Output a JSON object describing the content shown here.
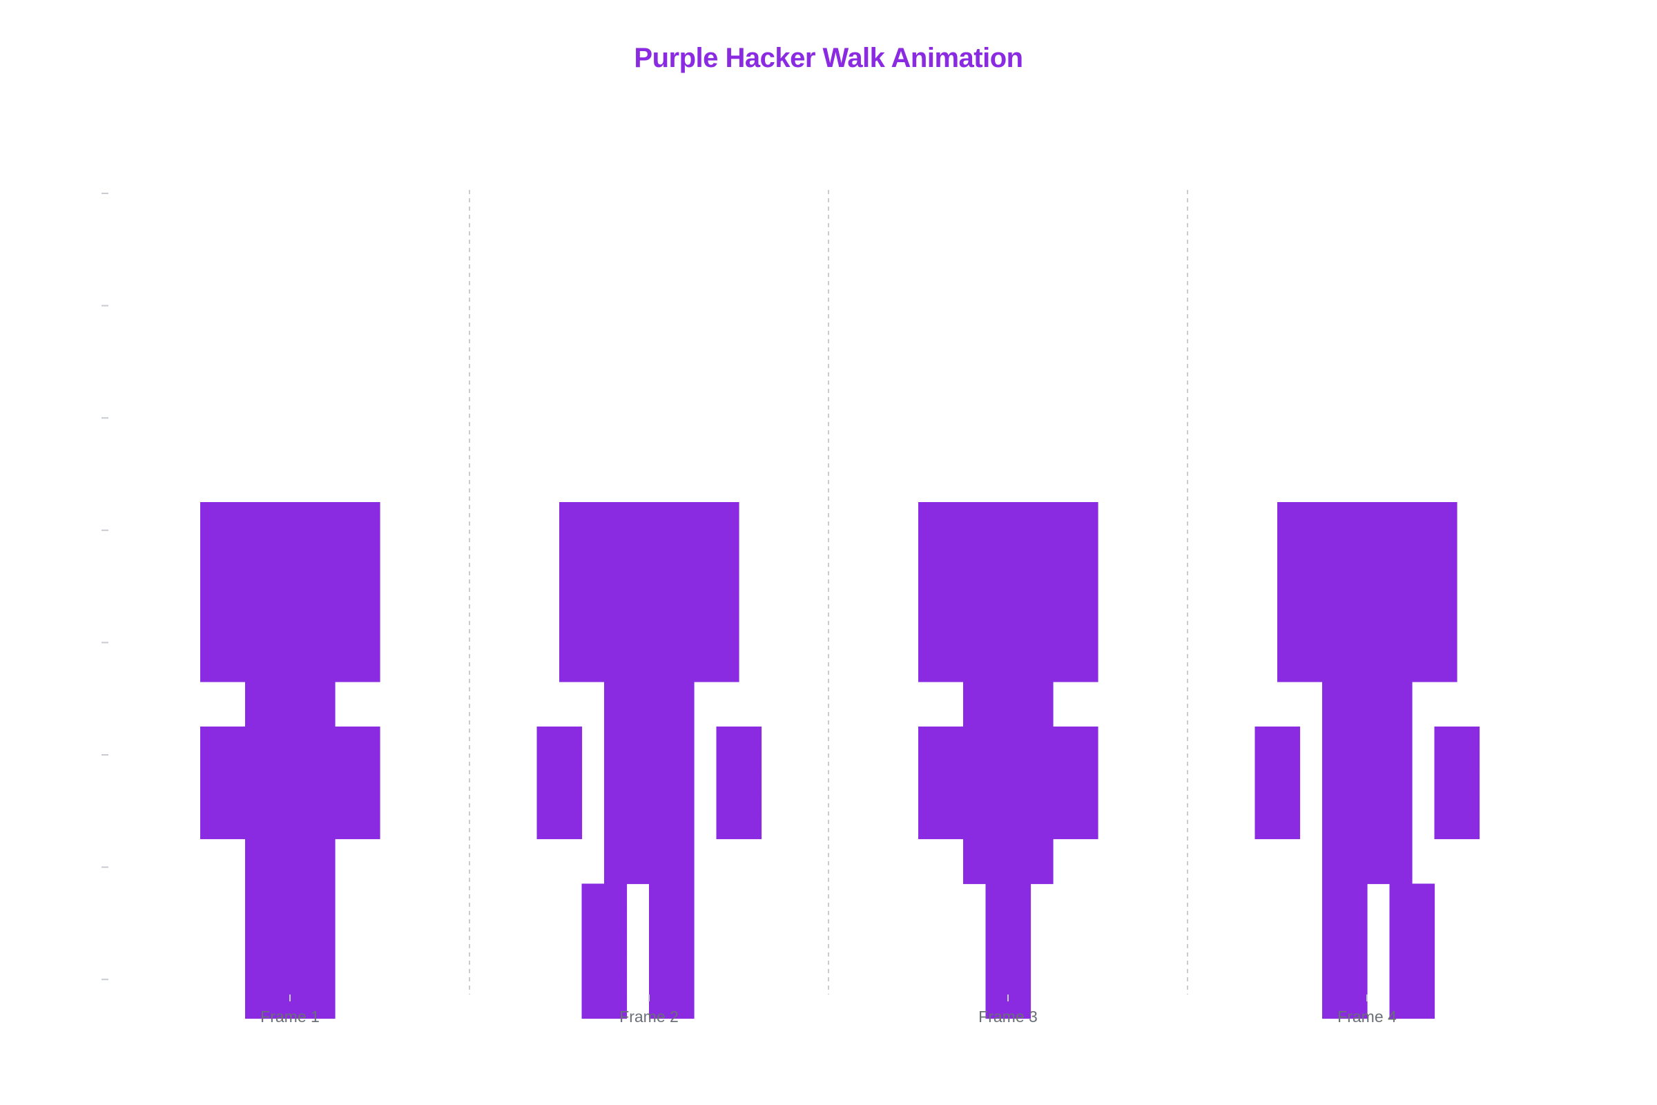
{
  "title": "Purple Hacker Walk Animation",
  "colors": {
    "title": "#8a2be2",
    "sprite": "#8a2be2",
    "separator": "#c8ccd2",
    "tick": "#c8ccd2",
    "label": "#6b6f76"
  },
  "chart_data": {
    "type": "heatmap",
    "title": "Purple Hacker Walk Animation",
    "xlabel": "",
    "ylabel": "",
    "categories": [
      "Frame 1",
      "Frame 2",
      "Frame 3",
      "Frame 4"
    ],
    "grid": false,
    "y_ticks_labeled": false,
    "frame_separators": "dashed vertical",
    "sprite_rows_top_to_bottom": true,
    "frames": [
      {
        "name": "Frame 1",
        "pixels": [
          [
            1,
            1,
            1,
            1,
            1,
            1,
            1,
            1
          ],
          [
            1,
            1,
            1,
            1,
            1,
            1,
            1,
            1
          ],
          [
            1,
            1,
            1,
            1,
            1,
            1,
            1,
            1
          ],
          [
            1,
            1,
            1,
            1,
            1,
            1,
            1,
            1
          ],
          [
            1,
            1,
            1,
            1,
            1,
            1,
            1,
            1
          ],
          [
            1,
            1,
            1,
            1,
            1,
            1,
            1,
            1
          ],
          [
            1,
            1,
            1,
            1,
            1,
            1,
            1,
            1
          ],
          [
            1,
            1,
            1,
            1,
            1,
            1,
            1,
            1
          ],
          [
            0,
            0,
            1,
            1,
            1,
            1,
            0,
            0
          ],
          [
            0,
            0,
            1,
            1,
            1,
            1,
            0,
            0
          ],
          [
            1,
            1,
            1,
            1,
            1,
            1,
            1,
            1
          ],
          [
            1,
            1,
            1,
            1,
            1,
            1,
            1,
            1
          ],
          [
            1,
            1,
            1,
            1,
            1,
            1,
            1,
            1
          ],
          [
            1,
            1,
            1,
            1,
            1,
            1,
            1,
            1
          ],
          [
            1,
            1,
            1,
            1,
            1,
            1,
            1,
            1
          ],
          [
            0,
            0,
            1,
            1,
            1,
            1,
            0,
            0
          ],
          [
            0,
            0,
            1,
            1,
            1,
            1,
            0,
            0
          ],
          [
            0,
            0,
            1,
            1,
            1,
            1,
            0,
            0
          ],
          [
            0,
            0,
            1,
            1,
            1,
            1,
            0,
            0
          ],
          [
            0,
            0,
            1,
            1,
            1,
            1,
            0,
            0
          ],
          [
            0,
            0,
            1,
            1,
            1,
            1,
            0,
            0
          ],
          [
            0,
            0,
            1,
            1,
            1,
            1,
            0,
            0
          ],
          [
            0,
            0,
            1,
            1,
            1,
            1,
            0,
            0
          ]
        ]
      },
      {
        "name": "Frame 2",
        "pixels": [
          [
            0,
            1,
            1,
            1,
            1,
            1,
            1,
            1,
            1,
            0
          ],
          [
            0,
            1,
            1,
            1,
            1,
            1,
            1,
            1,
            1,
            0
          ],
          [
            0,
            1,
            1,
            1,
            1,
            1,
            1,
            1,
            1,
            0
          ],
          [
            0,
            1,
            1,
            1,
            1,
            1,
            1,
            1,
            1,
            0
          ],
          [
            0,
            1,
            1,
            1,
            1,
            1,
            1,
            1,
            1,
            0
          ],
          [
            0,
            1,
            1,
            1,
            1,
            1,
            1,
            1,
            1,
            0
          ],
          [
            0,
            1,
            1,
            1,
            1,
            1,
            1,
            1,
            1,
            0
          ],
          [
            0,
            1,
            1,
            1,
            1,
            1,
            1,
            1,
            1,
            0
          ],
          [
            0,
            0,
            0,
            1,
            1,
            1,
            1,
            0,
            0,
            0
          ],
          [
            0,
            0,
            0,
            1,
            1,
            1,
            1,
            0,
            0,
            0
          ],
          [
            1,
            1,
            0,
            1,
            1,
            1,
            1,
            0,
            1,
            1
          ],
          [
            1,
            1,
            0,
            1,
            1,
            1,
            1,
            0,
            1,
            1
          ],
          [
            1,
            1,
            0,
            1,
            1,
            1,
            1,
            0,
            1,
            1
          ],
          [
            1,
            1,
            0,
            1,
            1,
            1,
            1,
            0,
            1,
            1
          ],
          [
            1,
            1,
            0,
            1,
            1,
            1,
            1,
            0,
            1,
            1
          ],
          [
            0,
            0,
            0,
            1,
            1,
            1,
            1,
            0,
            0,
            0
          ],
          [
            0,
            0,
            0,
            1,
            1,
            1,
            1,
            0,
            0,
            0
          ],
          [
            0,
            0,
            1,
            1,
            0,
            1,
            1,
            0,
            0,
            0
          ],
          [
            0,
            0,
            1,
            1,
            0,
            1,
            1,
            0,
            0,
            0
          ],
          [
            0,
            0,
            1,
            1,
            0,
            1,
            1,
            0,
            0,
            0
          ],
          [
            0,
            0,
            1,
            1,
            0,
            1,
            1,
            0,
            0,
            0
          ],
          [
            0,
            0,
            1,
            1,
            0,
            1,
            1,
            0,
            0,
            0
          ],
          [
            0,
            0,
            1,
            1,
            0,
            1,
            1,
            0,
            0,
            0
          ]
        ]
      },
      {
        "name": "Frame 3",
        "pixels": [
          [
            1,
            1,
            1,
            1,
            1,
            1,
            1,
            1
          ],
          [
            1,
            1,
            1,
            1,
            1,
            1,
            1,
            1
          ],
          [
            1,
            1,
            1,
            1,
            1,
            1,
            1,
            1
          ],
          [
            1,
            1,
            1,
            1,
            1,
            1,
            1,
            1
          ],
          [
            1,
            1,
            1,
            1,
            1,
            1,
            1,
            1
          ],
          [
            1,
            1,
            1,
            1,
            1,
            1,
            1,
            1
          ],
          [
            1,
            1,
            1,
            1,
            1,
            1,
            1,
            1
          ],
          [
            1,
            1,
            1,
            1,
            1,
            1,
            1,
            1
          ],
          [
            0,
            0,
            1,
            1,
            1,
            1,
            0,
            0
          ],
          [
            0,
            0,
            1,
            1,
            1,
            1,
            0,
            0
          ],
          [
            1,
            1,
            1,
            1,
            1,
            1,
            1,
            1
          ],
          [
            1,
            1,
            1,
            1,
            1,
            1,
            1,
            1
          ],
          [
            1,
            1,
            1,
            1,
            1,
            1,
            1,
            1
          ],
          [
            1,
            1,
            1,
            1,
            1,
            1,
            1,
            1
          ],
          [
            1,
            1,
            1,
            1,
            1,
            1,
            1,
            1
          ],
          [
            0,
            0,
            1,
            1,
            1,
            1,
            0,
            0
          ],
          [
            0,
            0,
            1,
            1,
            1,
            1,
            0,
            0
          ],
          [
            0,
            0,
            0,
            1,
            1,
            0,
            0,
            0
          ],
          [
            0,
            0,
            0,
            1,
            1,
            0,
            0,
            0
          ],
          [
            0,
            0,
            0,
            1,
            1,
            0,
            0,
            0
          ],
          [
            0,
            0,
            0,
            1,
            1,
            0,
            0,
            0
          ],
          [
            0,
            0,
            0,
            1,
            1,
            0,
            0,
            0
          ],
          [
            0,
            0,
            0,
            1,
            1,
            0,
            0,
            0
          ]
        ]
      },
      {
        "name": "Frame 4",
        "pixels": [
          [
            0,
            1,
            1,
            1,
            1,
            1,
            1,
            1,
            1,
            0
          ],
          [
            0,
            1,
            1,
            1,
            1,
            1,
            1,
            1,
            1,
            0
          ],
          [
            0,
            1,
            1,
            1,
            1,
            1,
            1,
            1,
            1,
            0
          ],
          [
            0,
            1,
            1,
            1,
            1,
            1,
            1,
            1,
            1,
            0
          ],
          [
            0,
            1,
            1,
            1,
            1,
            1,
            1,
            1,
            1,
            0
          ],
          [
            0,
            1,
            1,
            1,
            1,
            1,
            1,
            1,
            1,
            0
          ],
          [
            0,
            1,
            1,
            1,
            1,
            1,
            1,
            1,
            1,
            0
          ],
          [
            0,
            1,
            1,
            1,
            1,
            1,
            1,
            1,
            1,
            0
          ],
          [
            0,
            0,
            0,
            1,
            1,
            1,
            1,
            0,
            0,
            0
          ],
          [
            0,
            0,
            0,
            1,
            1,
            1,
            1,
            0,
            0,
            0
          ],
          [
            1,
            1,
            0,
            1,
            1,
            1,
            1,
            0,
            1,
            1
          ],
          [
            1,
            1,
            0,
            1,
            1,
            1,
            1,
            0,
            1,
            1
          ],
          [
            1,
            1,
            0,
            1,
            1,
            1,
            1,
            0,
            1,
            1
          ],
          [
            1,
            1,
            0,
            1,
            1,
            1,
            1,
            0,
            1,
            1
          ],
          [
            1,
            1,
            0,
            1,
            1,
            1,
            1,
            0,
            1,
            1
          ],
          [
            0,
            0,
            0,
            1,
            1,
            1,
            1,
            0,
            0,
            0
          ],
          [
            0,
            0,
            0,
            1,
            1,
            1,
            1,
            0,
            0,
            0
          ],
          [
            0,
            0,
            0,
            1,
            1,
            0,
            1,
            1,
            0,
            0
          ],
          [
            0,
            0,
            0,
            1,
            1,
            0,
            1,
            1,
            0,
            0
          ],
          [
            0,
            0,
            0,
            1,
            1,
            0,
            1,
            1,
            0,
            0
          ],
          [
            0,
            0,
            0,
            1,
            1,
            0,
            1,
            1,
            0,
            0
          ],
          [
            0,
            0,
            0,
            1,
            1,
            0,
            1,
            1,
            0,
            0
          ],
          [
            0,
            0,
            0,
            1,
            1,
            0,
            1,
            1,
            0,
            0
          ]
        ]
      }
    ]
  }
}
